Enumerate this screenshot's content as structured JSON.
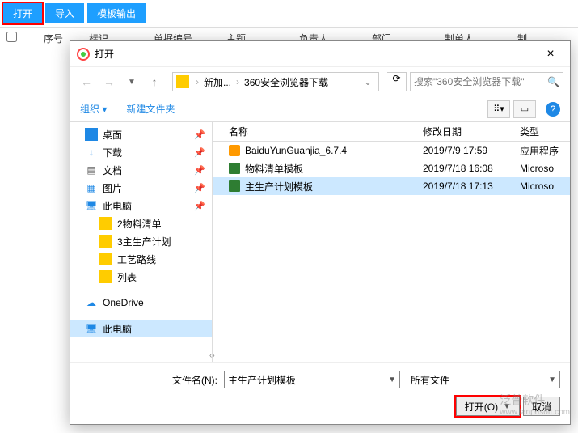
{
  "toolbar": {
    "open": "打开",
    "import": "导入",
    "template_out": "模板输出"
  },
  "table": {
    "cols": [
      "序号",
      "标识",
      "单据编号",
      "主题",
      "负责人",
      "部门",
      "制单人",
      "制"
    ]
  },
  "dialog": {
    "title": "打开",
    "breadcrumb": {
      "p1": "新加...",
      "p2": "360安全浏览器下载"
    },
    "search_placeholder": "搜索\"360安全浏览器下载\"",
    "organize": "组织",
    "new_folder": "新建文件夹",
    "view_label": "⠿",
    "tree": [
      {
        "label": "桌面",
        "icon": "ic-desktop",
        "pin": true
      },
      {
        "label": "下载",
        "icon": "ic-download",
        "pin": true,
        "glyph": "↓"
      },
      {
        "label": "文档",
        "icon": "ic-doc",
        "pin": true,
        "glyph": "▤"
      },
      {
        "label": "图片",
        "icon": "ic-pic",
        "pin": true,
        "glyph": "▦"
      },
      {
        "label": "此电脑",
        "icon": "ic-pc",
        "pin": true,
        "glyph": "🖥"
      },
      {
        "label": "2物料清单",
        "icon": "ic-folder",
        "indent": true
      },
      {
        "label": "3主生产计划",
        "icon": "ic-folder",
        "indent": true
      },
      {
        "label": "工艺路线",
        "icon": "ic-folder",
        "indent": true
      },
      {
        "label": "列表",
        "icon": "ic-folder",
        "indent": true
      },
      {
        "label": "OneDrive",
        "icon": "ic-cloud",
        "glyph": "☁",
        "spacer_before": true
      },
      {
        "label": "此电脑",
        "icon": "ic-pc",
        "glyph": "🖥",
        "selected": true,
        "spacer_before": true
      }
    ],
    "file_cols": {
      "name": "名称",
      "date": "修改日期",
      "type": "类型"
    },
    "files": [
      {
        "name": "BaiduYunGuanjia_6.7.4",
        "date": "2019/7/9 17:59",
        "type": "应用程序",
        "icon": "fi-exe"
      },
      {
        "name": "物料清单模板",
        "date": "2019/7/18 16:08",
        "type": "Microso",
        "icon": "fi-xls"
      },
      {
        "name": "主生产计划模板",
        "date": "2019/7/18 17:13",
        "type": "Microso",
        "icon": "fi-xls",
        "selected": true
      }
    ],
    "filename_label": "文件名(N):",
    "filename_value": "主生产计划模板",
    "filetype_value": "所有文件",
    "btn_open": "打开(O)",
    "btn_cancel": "取消"
  },
  "watermark": {
    "name": "泛普软件",
    "url": "www.fanpusoft.com"
  }
}
